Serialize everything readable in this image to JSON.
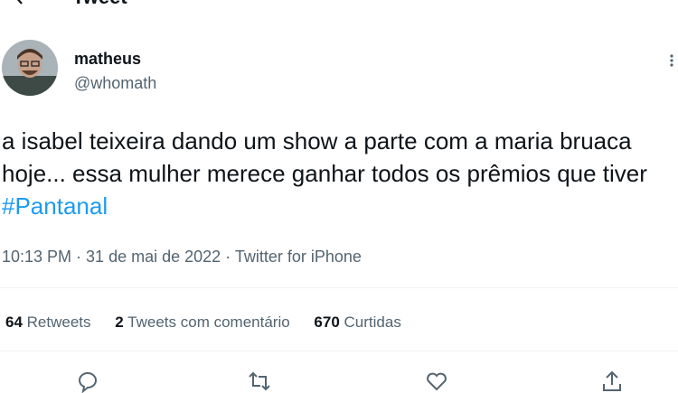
{
  "header": {
    "title": "Tweet",
    "back_icon": "arrow-left-icon"
  },
  "author": {
    "name": "matheus",
    "handle": "@whomath",
    "avatar_icon": "user-avatar"
  },
  "tweet": {
    "text_before": "a isabel teixeira dando um show a parte com a maria bruaca hoje... essa mulher merece ganhar todos os prêmios que tiver ",
    "hashtag": "#Pantanal"
  },
  "meta": {
    "time": "10:13 PM",
    "sep1": " · ",
    "date": "31 de mai de 2022",
    "sep2": " · ",
    "source": "Twitter for iPhone"
  },
  "stats": {
    "retweets_count": "64",
    "retweets_label": "Retweets",
    "quotes_count": "2",
    "quotes_label": "Tweets com comentário",
    "likes_count": "670",
    "likes_label": "Curtidas"
  },
  "actions": [
    "reply-icon",
    "retweet-icon",
    "like-icon",
    "share-icon"
  ],
  "colors": {
    "link": "#1d9bf0",
    "secondary": "#536471",
    "text": "#0f1419",
    "divider": "#eff3f4"
  }
}
